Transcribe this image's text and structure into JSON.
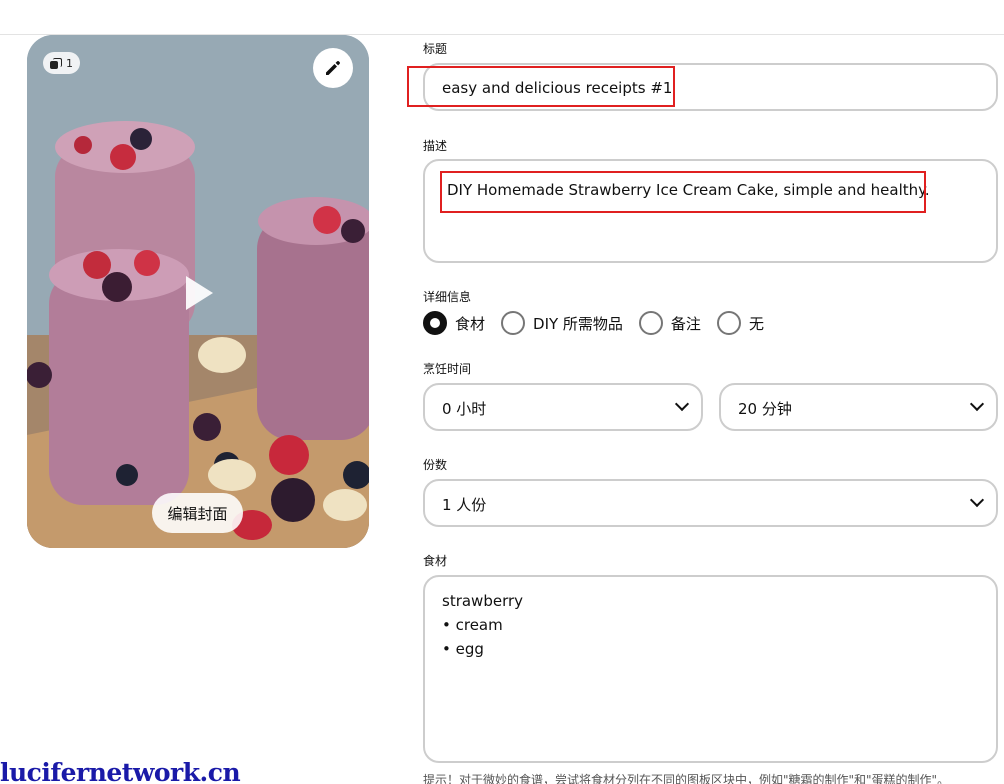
{
  "media": {
    "page_count": "1",
    "cover_button_label": "编辑封面"
  },
  "form": {
    "title": {
      "label": "标题",
      "value": "easy and delicious receipts #1"
    },
    "description": {
      "label": "描述",
      "value": "DIY Homemade Strawberry Ice Cream Cake, simple and healthy."
    },
    "details": {
      "label": "详细信息",
      "options": [
        {
          "label": "食材",
          "checked": true
        },
        {
          "label": "DIY 所需物品",
          "checked": false
        },
        {
          "label": "备注",
          "checked": false
        },
        {
          "label": "无",
          "checked": false
        }
      ]
    },
    "cook_time": {
      "label": "烹饪时间",
      "hours": "0 小时",
      "minutes": "20 分钟"
    },
    "servings": {
      "label": "份数",
      "value": "1 人份"
    },
    "ingredients": {
      "label": "食材",
      "lines": [
        "strawberry",
        "• cream",
        "• egg"
      ]
    },
    "hint": "提示！对于微妙的食谱，尝试将食材分列在不同的图板区块中，例如\"糖霜的制作\"和\"蛋糕的制作\"。"
  },
  "watermark": "lucifernetwork.cn",
  "colors": {
    "highlight": "#e02020",
    "border": "#cdcdcd",
    "watermark": "#1a1aa8"
  }
}
